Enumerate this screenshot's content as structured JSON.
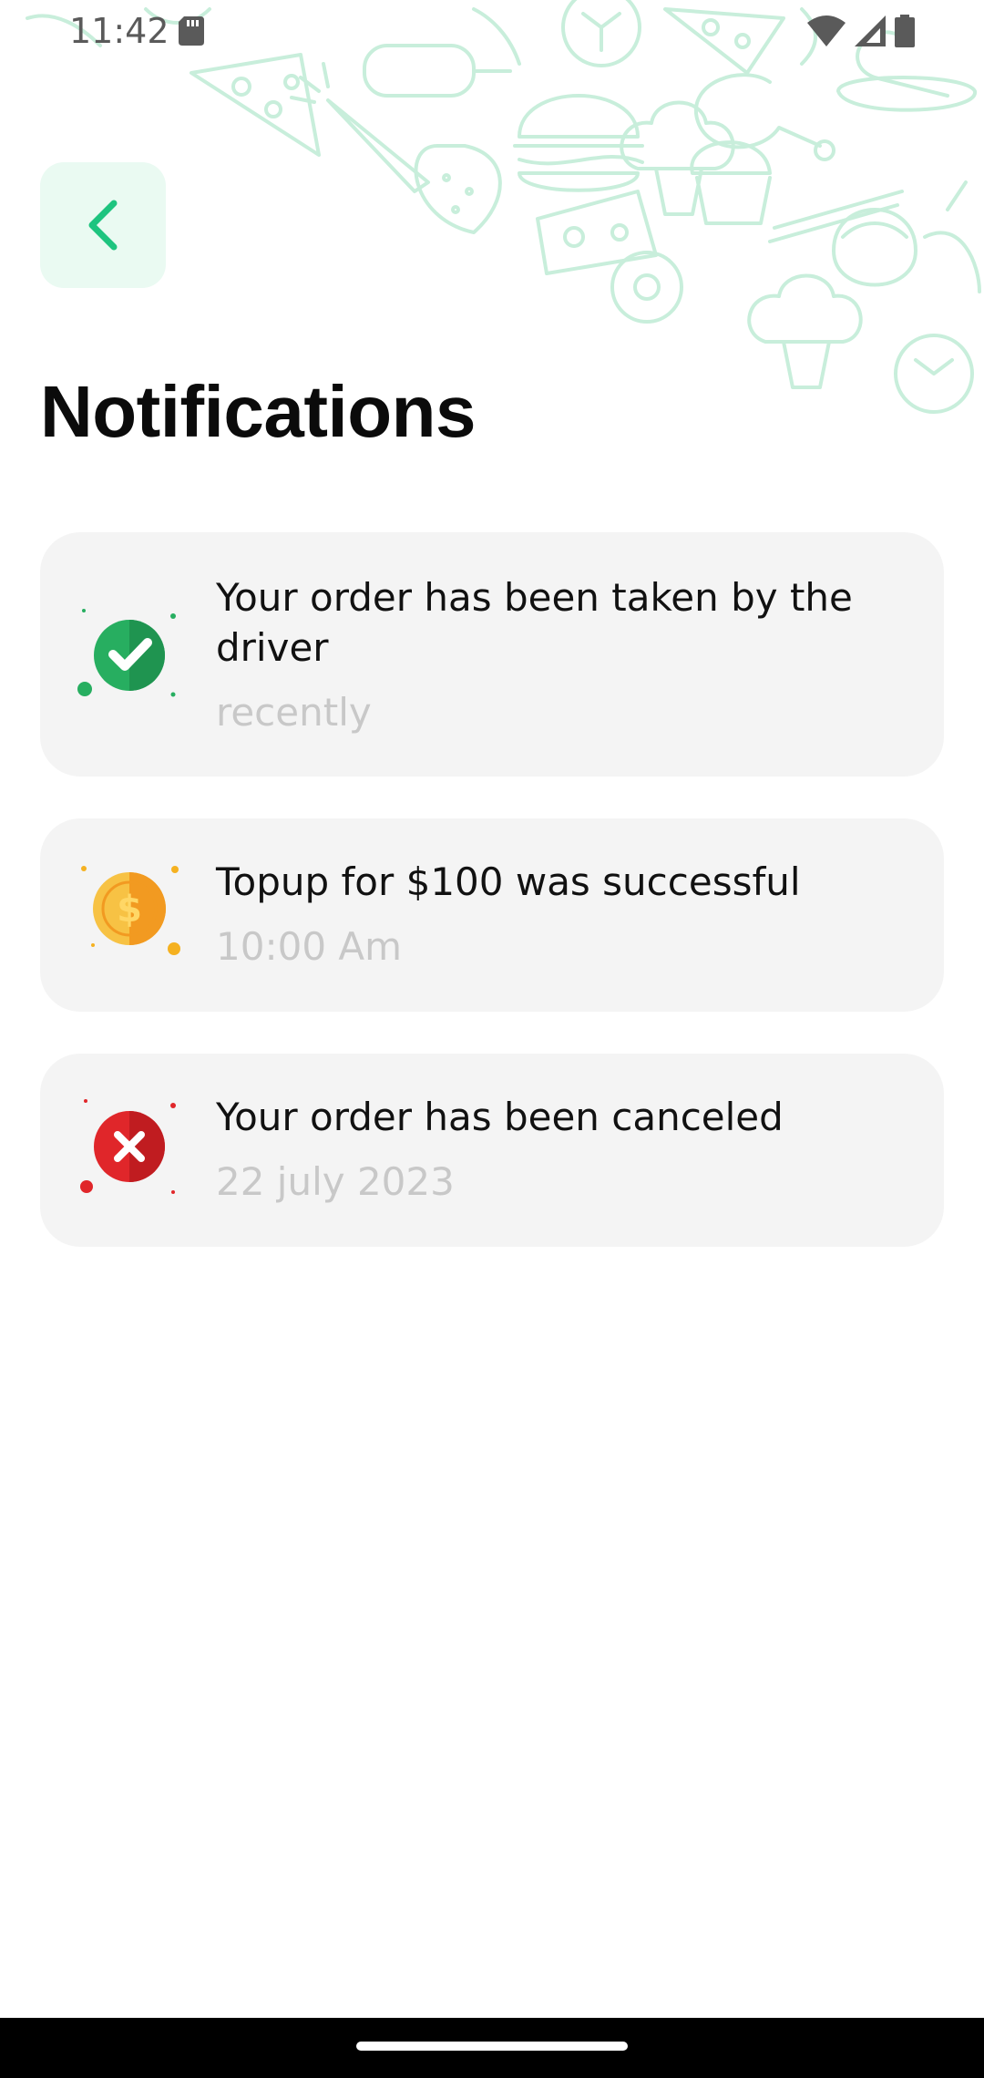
{
  "status_bar": {
    "time": "11:42"
  },
  "header": {
    "back_button_label": "Back",
    "title": "Notifications"
  },
  "notifications": [
    {
      "icon": "check-circle-icon",
      "title": "Your order has been taken by the driver",
      "time": "recently",
      "accent": "#27ae60"
    },
    {
      "icon": "coin-icon",
      "title": "Topup for $100 was successful",
      "time": "10:00 Am",
      "accent": "#f5b120"
    },
    {
      "icon": "cross-circle-icon",
      "title": "Your order has been canceled",
      "time": "22 july 2023",
      "accent": "#e0262a"
    }
  ],
  "colors": {
    "brand_green": "#1ec47f",
    "back_button_bg": "#eafaf2",
    "card_bg": "#f4f4f4",
    "muted_text": "#c8c8c8"
  }
}
